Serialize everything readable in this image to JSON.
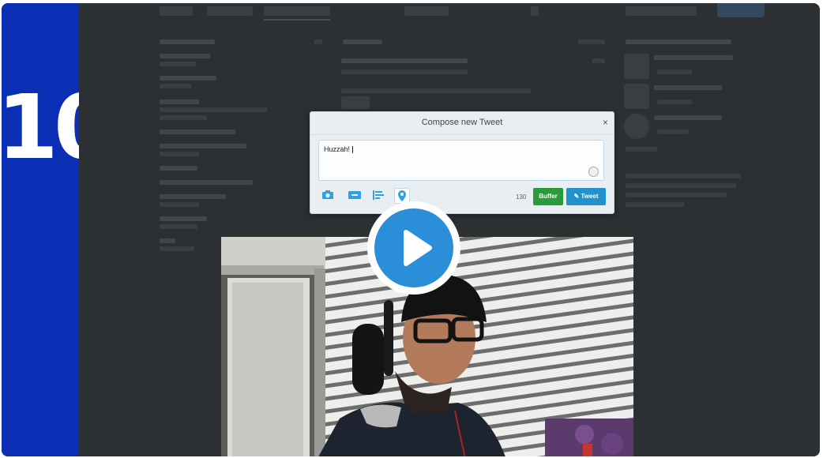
{
  "frame": {
    "slide_number": "10"
  },
  "compose": {
    "title": "Compose new Tweet",
    "close_label": "×",
    "text": "Huzzah! ",
    "char_count": "130",
    "buffer_label": "Buffer",
    "tweet_label": "Tweet",
    "tools": [
      "camera-icon",
      "gif-icon",
      "poll-icon",
      "location-icon"
    ]
  },
  "video": {
    "state": "paused",
    "play_icon": "play-icon"
  },
  "colors": {
    "accent_blue": "#2392cc",
    "buffer_green": "#2a9a3a",
    "strip_blue": "#0a2fb4",
    "overlay": "#2d3033"
  }
}
